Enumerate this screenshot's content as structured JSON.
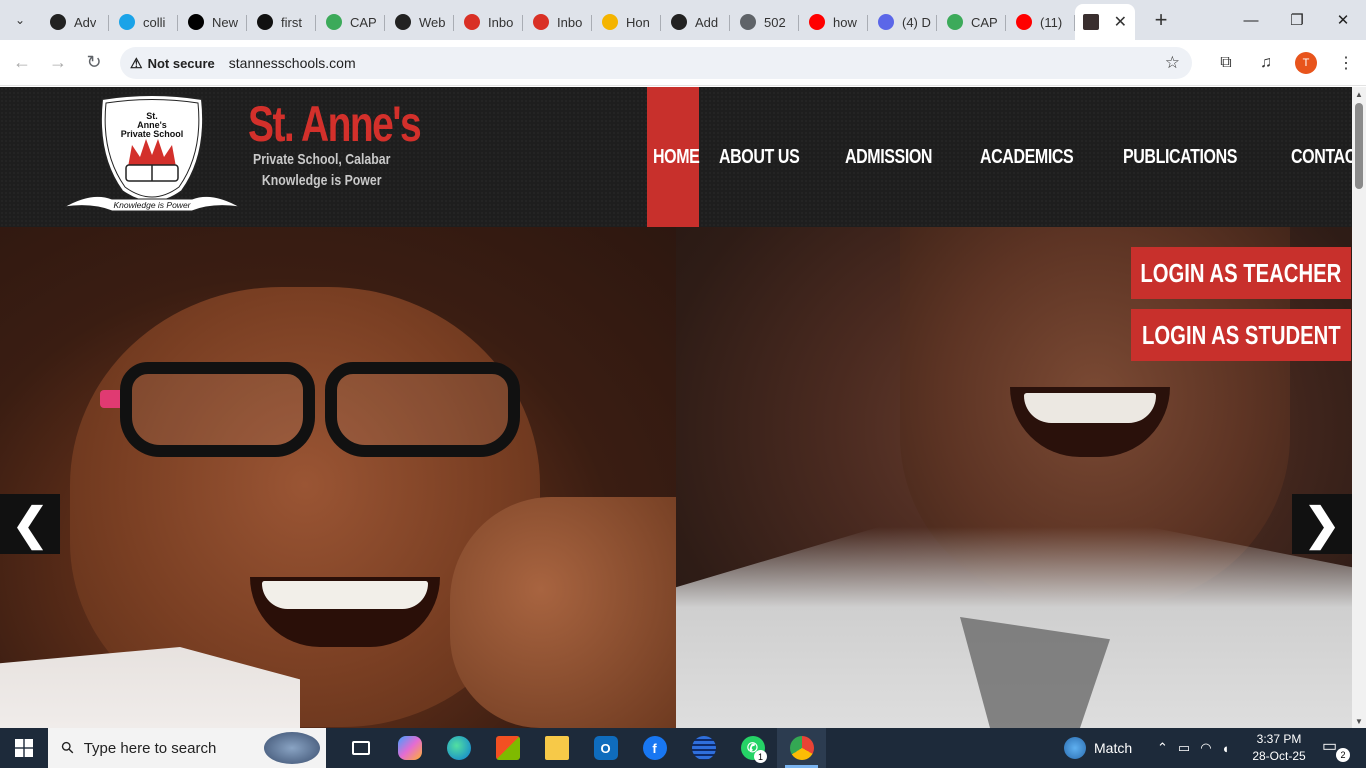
{
  "browser": {
    "tabs": [
      {
        "label": "Adv",
        "icon": "openai-icon",
        "color": "#222222"
      },
      {
        "label": "colli",
        "icon": "circle-o-icon",
        "color": "#1aa3e8"
      },
      {
        "label": "New",
        "icon": "triangle-icon",
        "color": "#000000"
      },
      {
        "label": "first",
        "icon": "github-icon",
        "color": "#111111"
      },
      {
        "label": "CAP",
        "icon": "leaf-icon",
        "color": "#3caa5a"
      },
      {
        "label": "Web",
        "icon": "openai-icon",
        "color": "#222222"
      },
      {
        "label": "Inbo",
        "icon": "gmail-icon",
        "color": "#d93025"
      },
      {
        "label": "Inbo",
        "icon": "gmail-icon",
        "color": "#d93025"
      },
      {
        "label": "Hon",
        "icon": "adsense-icon",
        "color": "#f4b400"
      },
      {
        "label": "Add",
        "icon": "openai-icon",
        "color": "#222222"
      },
      {
        "label": "502",
        "icon": "globe-icon",
        "color": "#5f6368"
      },
      {
        "label": "how",
        "icon": "youtube-icon",
        "color": "#ff0000"
      },
      {
        "label": "(4) D",
        "icon": "chat-icon",
        "color": "#5b67e8"
      },
      {
        "label": "CAP",
        "icon": "leaf-icon",
        "color": "#3caa5a"
      },
      {
        "label": "(11)",
        "icon": "youtube-icon",
        "color": "#ff0000"
      }
    ],
    "active_tab_close": "✕",
    "new_tab": "+",
    "window": {
      "minimize": "—",
      "restore": "❐",
      "close": "✕"
    },
    "security_label": "Not secure",
    "url": "stannesschools.com",
    "avatar_letter": "T"
  },
  "site": {
    "crest": {
      "top_text_1": "St.",
      "top_text_2": "Anne's",
      "top_text_3": "Private School",
      "ribbon": "Knowledge is Power"
    },
    "brand_name": "St. Anne's",
    "brand_sub_1": "Private School, Calabar",
    "brand_sub_2": "Knowledge is Power",
    "nav": [
      "HOME",
      "ABOUT US",
      "ADMISSION",
      "ACADEMICS",
      "PUBLICATIONS",
      "CONTACTS"
    ],
    "active_nav": "HOME",
    "login_teacher": "LOGIN AS TEACHER",
    "login_student": "LOGIN AS STUDENT",
    "prev_arrow": "❮",
    "next_arrow": "❯",
    "accent_color": "#c8302c"
  },
  "taskbar": {
    "search_placeholder": "Type here to search",
    "weather": "Match",
    "time": "3:37 PM",
    "date": "28-Oct-25",
    "notifications": "2",
    "whatsapp_badge": "1"
  }
}
